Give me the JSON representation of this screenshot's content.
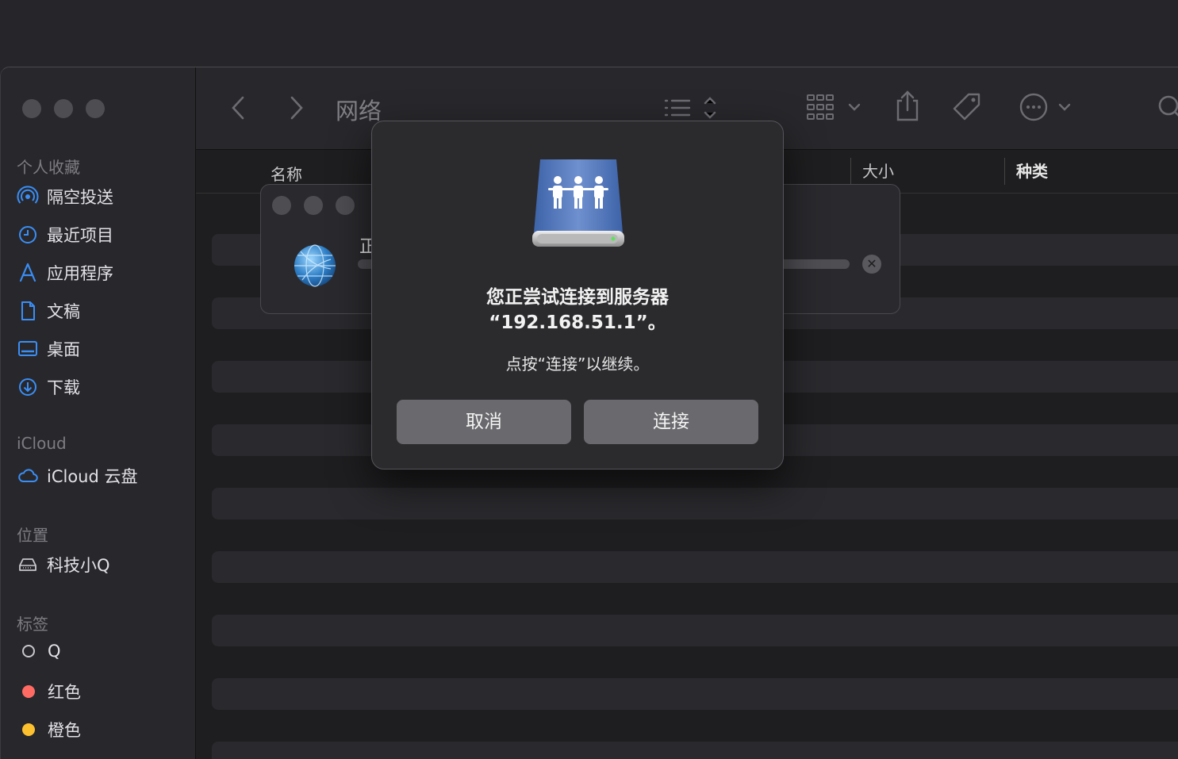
{
  "window": {
    "title": "网络"
  },
  "sidebar": {
    "favorites_title": "个人收藏",
    "favorites": [
      {
        "label": "隔空投送",
        "icon": "airdrop-icon"
      },
      {
        "label": "最近项目",
        "icon": "clock-icon"
      },
      {
        "label": "应用程序",
        "icon": "applications-icon"
      },
      {
        "label": "文稿",
        "icon": "document-icon"
      },
      {
        "label": "桌面",
        "icon": "desktop-icon"
      },
      {
        "label": "下载",
        "icon": "download-icon"
      }
    ],
    "icloud_title": "iCloud",
    "icloud": [
      {
        "label": "iCloud 云盘",
        "icon": "cloud-icon"
      }
    ],
    "locations_title": "位置",
    "locations": [
      {
        "label": "科技小Q",
        "icon": "disk-icon"
      }
    ],
    "tags_title": "标签",
    "tags": [
      {
        "label": "Q",
        "color": ""
      },
      {
        "label": "红色",
        "color": "#ff6b63"
      },
      {
        "label": "橙色",
        "color": "#fdc02f"
      }
    ]
  },
  "columns": {
    "name": "名称",
    "size": "大小",
    "kind": "种类"
  },
  "progress": {
    "text": "正",
    "icon": "network-globe-icon"
  },
  "dialog": {
    "icon": "server-share-icon",
    "message_line1": "您正尝试连接到服务器",
    "message_line2": "“192.168.51.1”。",
    "info": "点按“连接”以继续。",
    "cancel_label": "取消",
    "connect_label": "连接"
  }
}
